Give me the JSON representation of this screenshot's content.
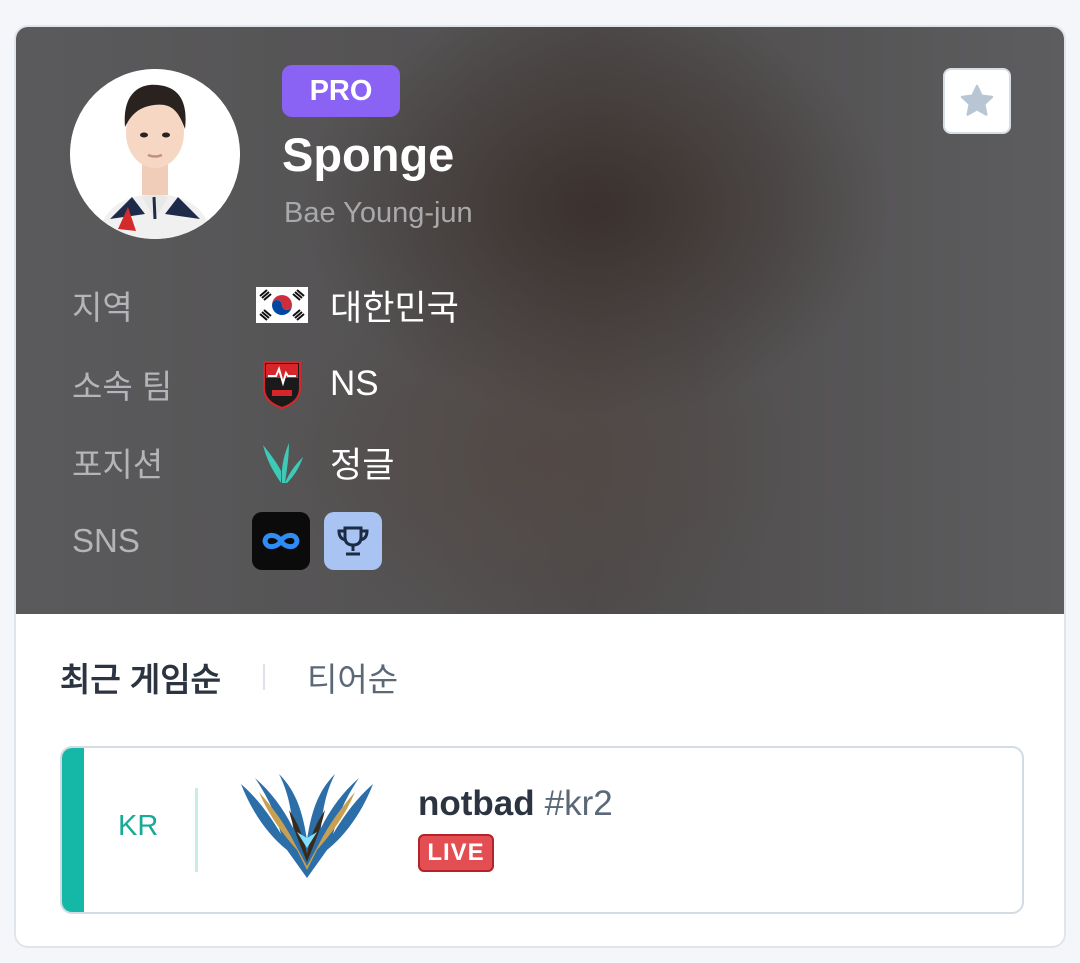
{
  "profile": {
    "badge": "PRO",
    "name": "Sponge",
    "real_name": "Bae Young-jun",
    "favorite_icon": "star-icon"
  },
  "info": {
    "region": {
      "label": "지역",
      "value": "대한민국",
      "icon": "south-korea-flag-icon"
    },
    "team": {
      "label": "소속 팀",
      "value": "NS",
      "icon": "team-logo-icon"
    },
    "position": {
      "label": "포지션",
      "value": "정글",
      "icon": "jungle-position-icon"
    },
    "sns": {
      "label": "SNS",
      "links": [
        "infinity-link-icon",
        "trophy-link-icon"
      ]
    }
  },
  "sort": {
    "active": "최근 게임순",
    "other": "티어순"
  },
  "accounts": [
    {
      "region": "KR",
      "name": "notbad",
      "tag": "#kr2",
      "status": "LIVE",
      "tier_icon": "challenger-emblem-icon"
    }
  ],
  "colors": {
    "pro_badge": "#8a63f5",
    "accent": "#15b8a6",
    "live": "#e34e52"
  }
}
